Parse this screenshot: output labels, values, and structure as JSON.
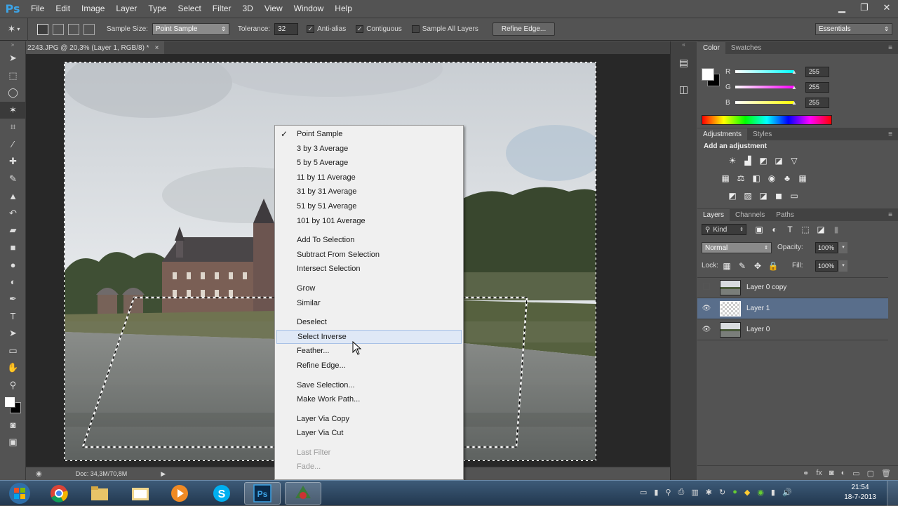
{
  "app": {
    "logo": "Ps"
  },
  "menu": [
    "File",
    "Edit",
    "Image",
    "Layer",
    "Type",
    "Select",
    "Filter",
    "3D",
    "View",
    "Window",
    "Help"
  ],
  "window_controls": {
    "minimize": "▁",
    "restore": "❐",
    "close": "✕"
  },
  "options": {
    "sample_size_label": "Sample Size:",
    "sample_size_value": "Point Sample",
    "tolerance_label": "Tolerance:",
    "tolerance_value": "32",
    "anti_alias_label": "Anti-alias",
    "anti_alias_checked": true,
    "contiguous_label": "Contiguous",
    "contiguous_checked": true,
    "sample_all_layers_label": "Sample All Layers",
    "sample_all_layers_checked": false,
    "refine_edge_label": "Refine Edge...",
    "workspace_value": "Essentials"
  },
  "document": {
    "tab_title": "2243.JPG @ 20,3% (Layer 1, RGB/8) *",
    "tab_close": "×",
    "status_doc": "Doc: 34,3M/70,8M"
  },
  "context_menu": {
    "groups": [
      [
        {
          "label": "Point Sample",
          "checked": true
        },
        {
          "label": "3 by 3 Average"
        },
        {
          "label": "5 by 5 Average"
        },
        {
          "label": "11 by 11 Average"
        },
        {
          "label": "31 by 31 Average"
        },
        {
          "label": "51 by 51 Average"
        },
        {
          "label": "101 by 101 Average"
        }
      ],
      [
        {
          "label": "Add To Selection"
        },
        {
          "label": "Subtract From Selection"
        },
        {
          "label": "Intersect Selection"
        }
      ],
      [
        {
          "label": "Grow"
        },
        {
          "label": "Similar"
        }
      ],
      [
        {
          "label": "Deselect"
        },
        {
          "label": "Select Inverse",
          "highlighted": true
        },
        {
          "label": "Feather..."
        },
        {
          "label": "Refine Edge..."
        }
      ],
      [
        {
          "label": "Save Selection..."
        },
        {
          "label": "Make Work Path..."
        }
      ],
      [
        {
          "label": "Layer Via Copy"
        },
        {
          "label": "Layer Via Cut"
        }
      ],
      [
        {
          "label": "Last Filter",
          "disabled": true
        },
        {
          "label": "Fade...",
          "disabled": true
        }
      ]
    ]
  },
  "color_panel": {
    "tabs": [
      "Color",
      "Swatches"
    ],
    "channels": [
      {
        "label": "R",
        "value": "255",
        "color": "#00ffff"
      },
      {
        "label": "G",
        "value": "255",
        "color": "#ff00ff"
      },
      {
        "label": "B",
        "value": "255",
        "color": "#ffff00"
      }
    ]
  },
  "adjustments_panel": {
    "tabs": [
      "Adjustments",
      "Styles"
    ],
    "heading": "Add an adjustment"
  },
  "layers_panel": {
    "tabs": [
      "Layers",
      "Channels",
      "Paths"
    ],
    "filter_kind": "Kind",
    "blend_mode": "Normal",
    "opacity_label": "Opacity:",
    "opacity_value": "100%",
    "lock_label": "Lock:",
    "fill_label": "Fill:",
    "fill_value": "100%",
    "layers": [
      {
        "name": "Layer 0 copy",
        "visible": false,
        "selected": false
      },
      {
        "name": "Layer 1",
        "visible": true,
        "selected": true
      },
      {
        "name": "Layer 0",
        "visible": true,
        "selected": false
      }
    ]
  },
  "taskbar": {
    "clock_time": "21:54",
    "clock_date": "18-7-2013"
  },
  "colors": {
    "ui_bg": "#535353",
    "selection_hl": "#596e8b",
    "ps_blue": "#3da3e5"
  }
}
